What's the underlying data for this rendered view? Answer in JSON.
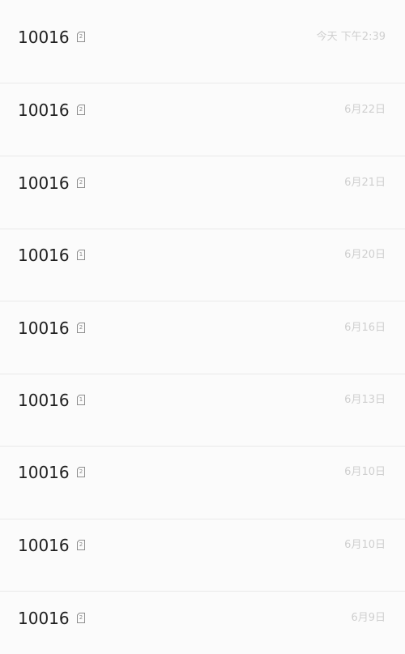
{
  "messages": [
    {
      "sender": "10016",
      "sim": "2",
      "date": "今天 下午2:39"
    },
    {
      "sender": "10016",
      "sim": "2",
      "date": "6月22日"
    },
    {
      "sender": "10016",
      "sim": "2",
      "date": "6月21日"
    },
    {
      "sender": "10016",
      "sim": "1",
      "date": "6月20日"
    },
    {
      "sender": "10016",
      "sim": "2",
      "date": "6月16日"
    },
    {
      "sender": "10016",
      "sim": "1",
      "date": "6月13日"
    },
    {
      "sender": "10016",
      "sim": "2",
      "date": "6月10日"
    },
    {
      "sender": "10016",
      "sim": "2",
      "date": "6月10日"
    },
    {
      "sender": "10016",
      "sim": "2",
      "date": "6月9日"
    }
  ],
  "icons": {
    "sim": "sim-card-icon"
  },
  "colors": {
    "background": "#fbfbfb",
    "divider": "#e9e9e9",
    "sender_text": "#1f1f1f",
    "date_text": "#cfcfcf",
    "sim_icon": "#8e8e8e"
  }
}
